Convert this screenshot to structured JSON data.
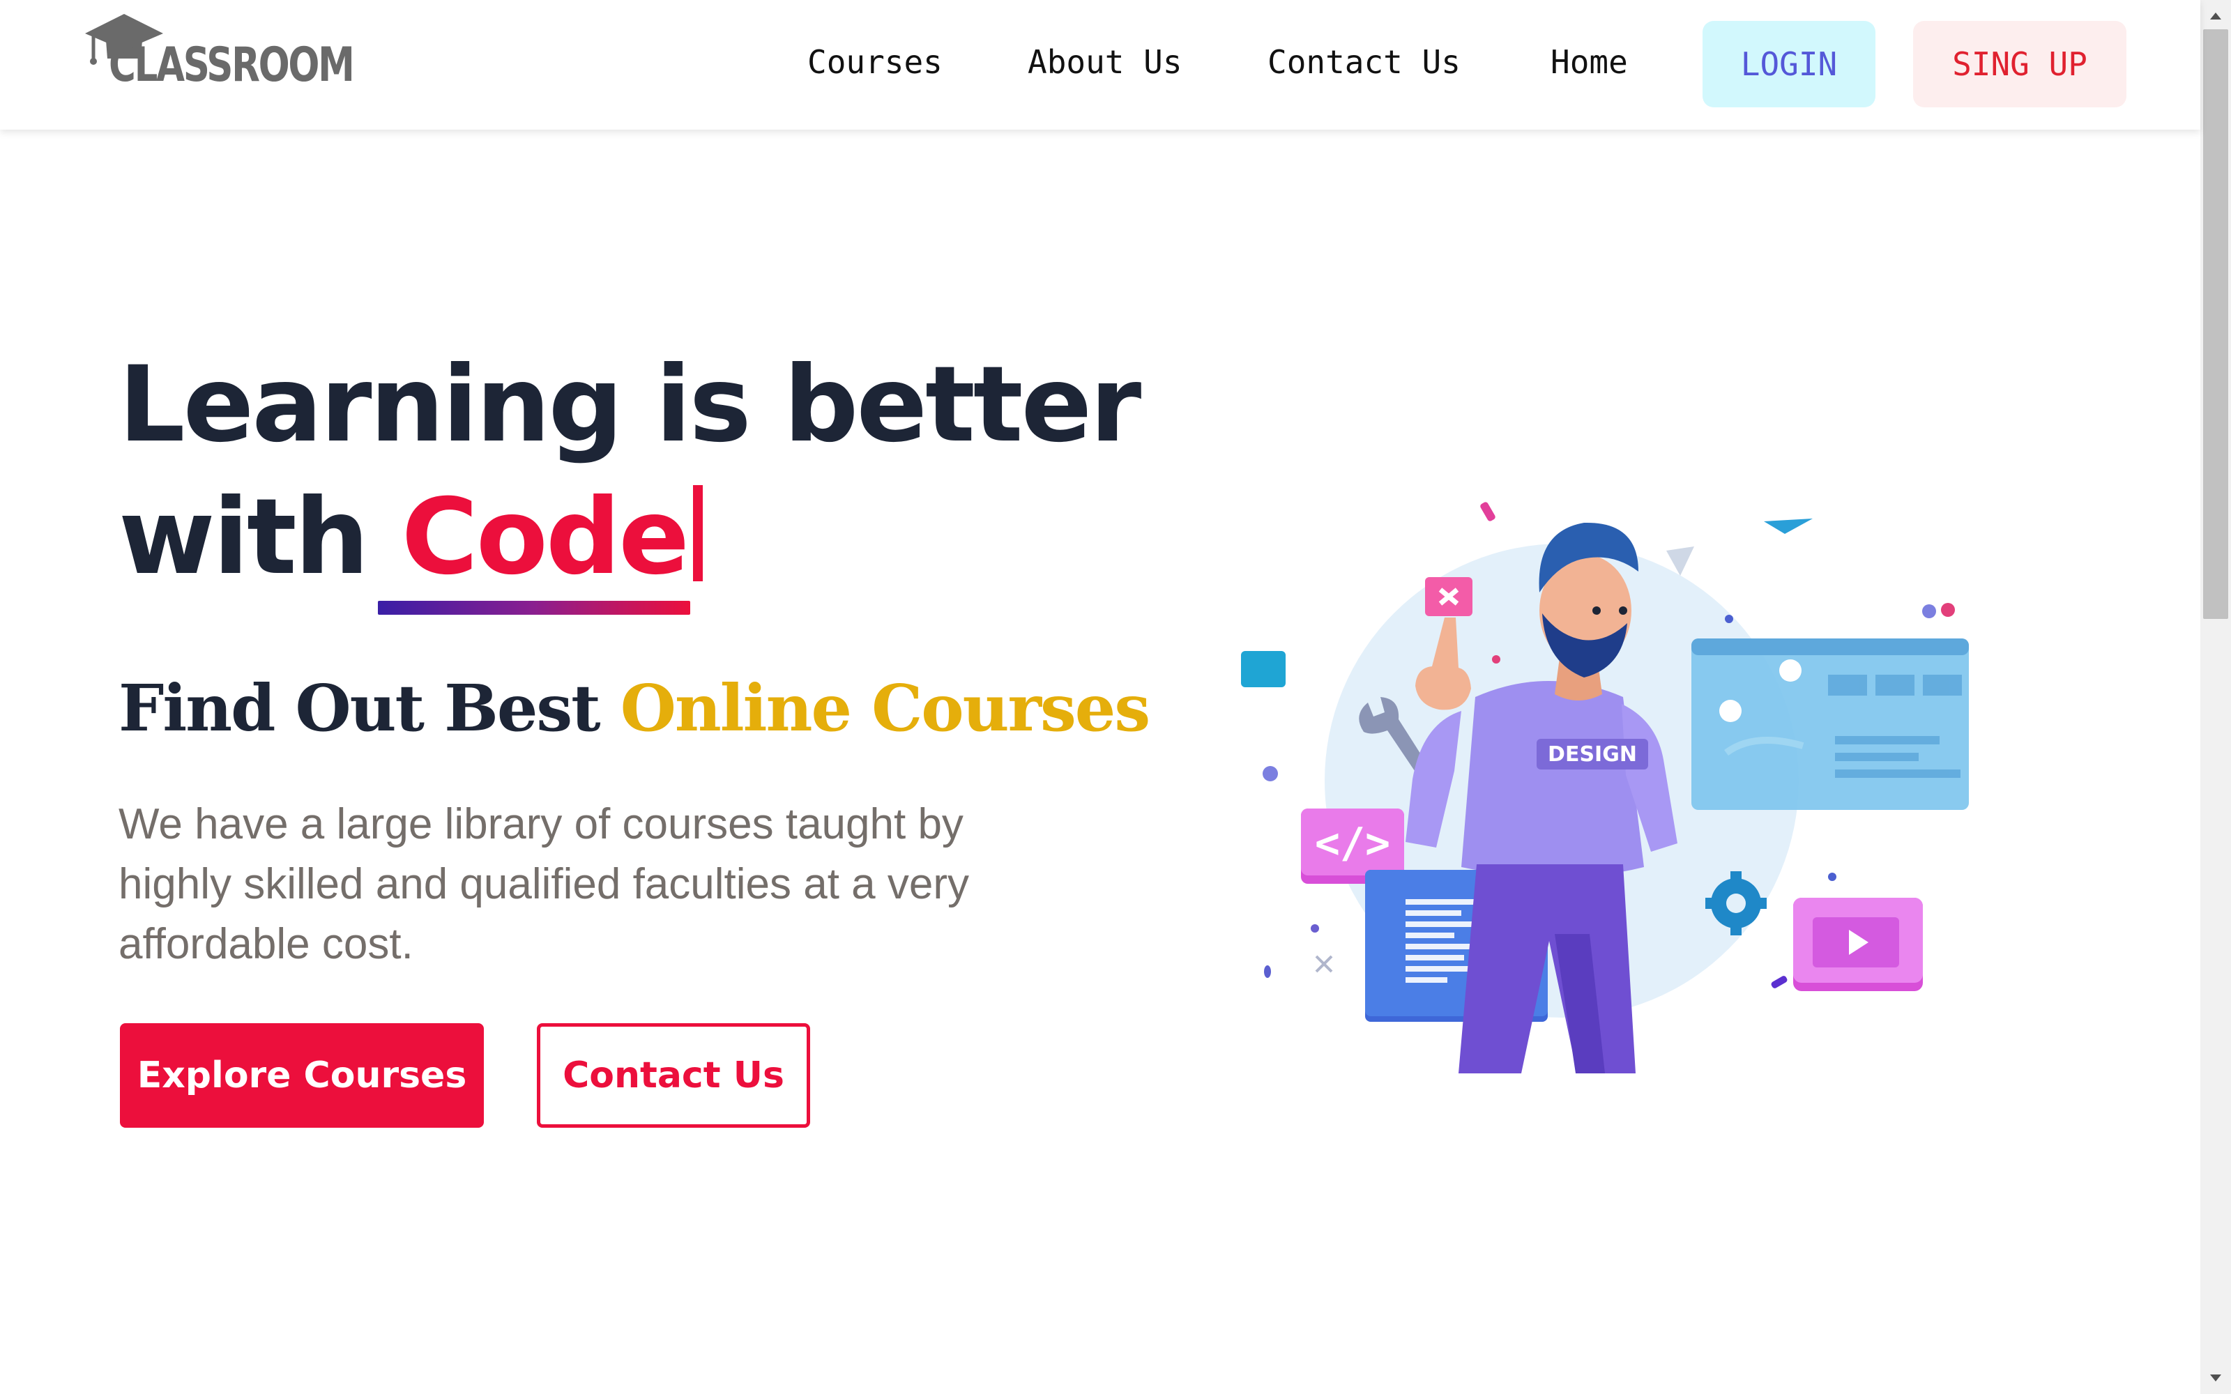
{
  "brand": {
    "logo_text": "CLASSROOM"
  },
  "nav": {
    "links": [
      "Courses",
      "About Us",
      "Contact Us",
      "Home"
    ],
    "login_label": "LOGIN",
    "signup_label": "SING UP"
  },
  "hero": {
    "title_line1": "Learning is better",
    "title_line2_prefix": "with",
    "title_line2_highlight": "Code",
    "subtitle_plain": "Find Out Best",
    "subtitle_highlight": "Online Courses",
    "description": "We have a large library of courses taught by highly skilled and qualified faculties at a very affordable cost.",
    "primary_button": "Explore Courses",
    "secondary_button": "Contact Us"
  },
  "illustration": {
    "shirt_text": "DESIGN"
  },
  "colors": {
    "accent_red": "#ec0f3c",
    "gold": "#e5ae0b",
    "dark_text": "#1d2536",
    "muted_text": "#746e6a",
    "login_bg": "#d2f8fd",
    "signup_bg": "#fdeeee"
  },
  "icons": {
    "logo": "graduation-cap-icon",
    "scroll_up": "scroll-up-arrow-icon",
    "scroll_down": "scroll-down-arrow-icon"
  }
}
